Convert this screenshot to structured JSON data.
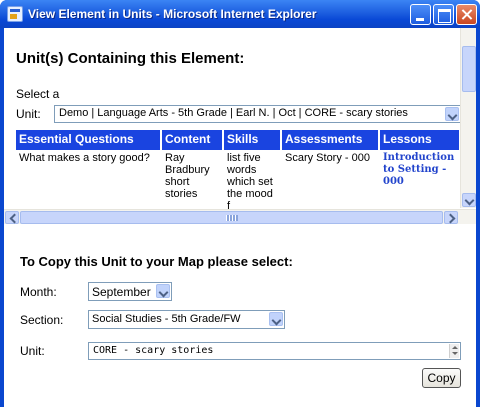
{
  "window": {
    "title": "View Element in Units - Microsoft Internet Explorer"
  },
  "upper": {
    "heading": "Unit(s) Containing this Element:",
    "select_a_label": "Select a",
    "unit_label": "Unit:",
    "unit_selected": "Demo | Language Arts - 5th Grade | Earl N. | Oct | CORE - scary stories",
    "columns": [
      {
        "header": "Essential Questions",
        "body": "What makes a story good?"
      },
      {
        "header": "Content",
        "body": "Ray Bradbury short stories"
      },
      {
        "header": "Skills",
        "body": "list five words which set the mood f"
      },
      {
        "header": "Assessments",
        "body": "Scary Story - 000"
      },
      {
        "header": "Lessons",
        "body": "Introduction to Setting - 000"
      }
    ]
  },
  "lower": {
    "heading": "To Copy this Unit to your Map please select:",
    "month_label": "Month:",
    "month_value": "September",
    "section_label": "Section:",
    "section_value": "Social Studies - 5th Grade/FW",
    "unit_label": "Unit:",
    "unit_value": "CORE - scary stories",
    "copy_button": "Copy"
  },
  "colors": {
    "header_blue": "#1a44e0",
    "link_blue": "#2244cc",
    "titlebar_blue": "#0a48d6"
  }
}
